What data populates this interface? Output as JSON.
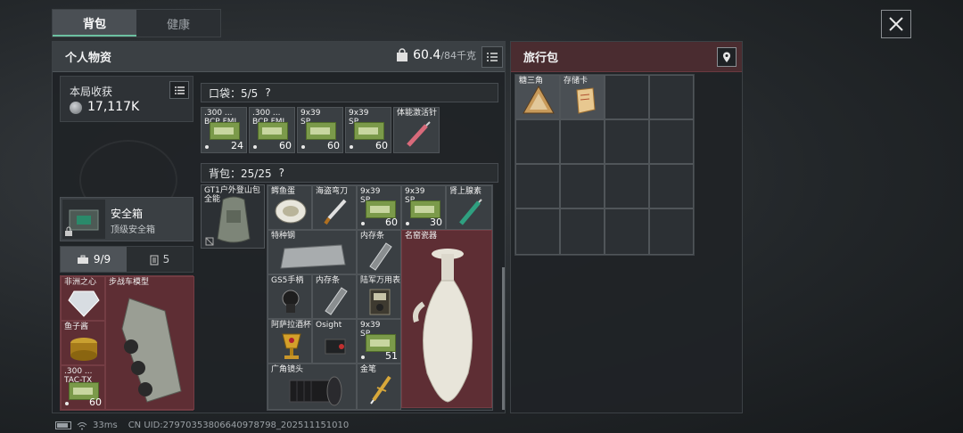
{
  "tabs": [
    {
      "label": "背包",
      "active": true
    },
    {
      "label": "健康",
      "active": false
    }
  ],
  "personal": {
    "title": "个人物资",
    "weight_value": "60.4",
    "weight_max": "/84千克"
  },
  "harvest": {
    "label": "本局收获",
    "value": "17,117K"
  },
  "safebox": {
    "name": "安全箱",
    "sub": "顶级安全箱"
  },
  "subtabs": [
    {
      "count": "9/9",
      "icon": "briefcase-icon"
    },
    {
      "count": "5",
      "icon": "clipboard-icon"
    }
  ],
  "safebox_items": {
    "diamond": "非洲之心",
    "vehicle": "步战车模型",
    "caviar": "鱼子酱",
    "ammo_name": ".300 ...\nTAC-TX",
    "ammo_count": "60"
  },
  "pocket": {
    "header": "口袋：5/5",
    "help": "?",
    "items": [
      {
        "name": ".300 ...\nBCP FMJ",
        "count": "24"
      },
      {
        "name": ".300 ...\nBCP FMJ",
        "count": "60"
      },
      {
        "name": "9x39\nSP...",
        "count": "60"
      },
      {
        "name": "9x39\nSP...",
        "count": "60"
      },
      {
        "name": "体能激活针",
        "count": ""
      }
    ]
  },
  "backpack": {
    "header": "背包：25/25",
    "help": "?",
    "bag_name": "GT1户外登山包\n全能",
    "items": {
      "crocodile": "鳄鱼蛋",
      "knife": "海盗弯刀",
      "ammo1_name": "9x39\nSP...",
      "ammo1_count": "60",
      "ammo2_name": "9x39\nSP...",
      "ammo2_count": "30",
      "adrenaline": "肾上腺素",
      "steel": "特种钢",
      "memory1": "内存条",
      "porcelain": "名窑瓷器",
      "grip": "GS5手柄",
      "memory2": "内存条",
      "watch": "陆军万用表",
      "cup": "阿萨拉酒杯",
      "sight": "Osight",
      "ammo3_name": "9x39\nSP...",
      "ammo3_count": "51",
      "lens": "广角镜头",
      "pen": "金笔"
    }
  },
  "travel": {
    "title": "旅行包",
    "items": [
      {
        "name": "糖三角"
      },
      {
        "name": "存储卡"
      }
    ]
  },
  "status": {
    "ping": "33ms",
    "uid": "CN UID:279703538066409787​98_202511151010"
  }
}
